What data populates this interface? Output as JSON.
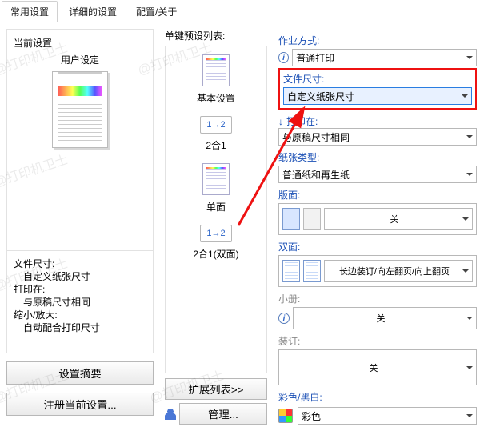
{
  "tabs": {
    "common": "常用设置",
    "detail": "详细的设置",
    "about": "配置/关于"
  },
  "left": {
    "cur_title": "当前设置",
    "user_setting": "用户设定",
    "info": {
      "doc_size_label": "文件尺寸:",
      "doc_size_value": "自定义纸张尺寸",
      "print_on_label": "打印在:",
      "print_on_value": "与原稿尺寸相同",
      "zoom_label": "缩小/放大:",
      "zoom_value": "自动配合打印尺寸"
    },
    "summary_btn": "设置摘要",
    "register_btn": "注册当前设置..."
  },
  "middle": {
    "title": "单键预设列表:",
    "items": {
      "basic": "基本设置",
      "twoInOne": "2合1",
      "oneSide": "单面",
      "twoInOneDuplex": "2合1(双面)",
      "merge": "1→2"
    },
    "expand_btn": "扩展列表>>",
    "manage_btn": "管理..."
  },
  "right": {
    "job_type_label": "作业方式:",
    "job_type_value": "普通打印",
    "doc_size_label": "文件尺寸:",
    "doc_size_value": "自定义纸张尺寸",
    "print_on_label": "打印在:",
    "print_on_value": "与原稿尺寸相同",
    "paper_type_label": "纸张类型:",
    "paper_type_value": "普通纸和再生纸",
    "layout_label": "版面:",
    "layout_value": "关",
    "duplex_label": "双面:",
    "duplex_value": "长边装订/向左翻页/向上翻页",
    "booklet_label": "小册:",
    "booklet_value": "关",
    "staple_label": "装订:",
    "staple_value": "关",
    "color_label": "彩色/黑白:",
    "color_value": "彩色"
  }
}
